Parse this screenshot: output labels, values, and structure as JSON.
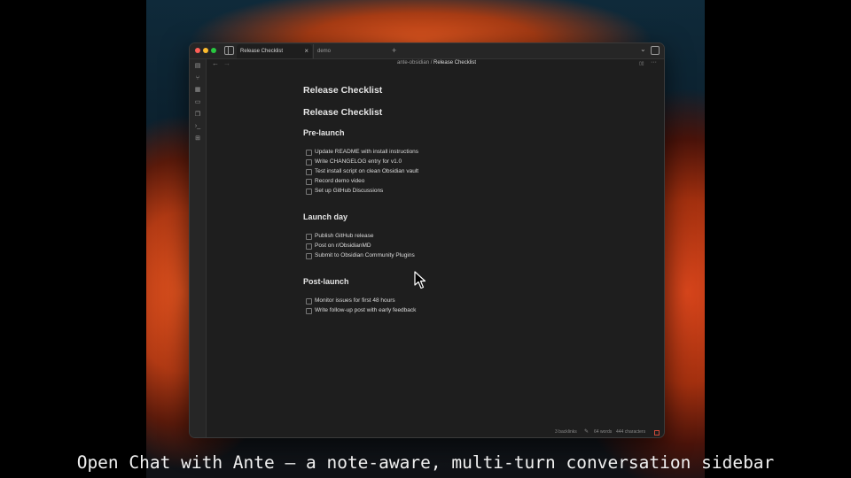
{
  "window": {
    "tabs": [
      {
        "label": "Release Checklist",
        "active": true
      },
      {
        "label": "demo",
        "active": false
      }
    ],
    "close_glyph": "×",
    "new_tab_glyph": "+",
    "chevron_glyph": "⌄"
  },
  "ribbon": {
    "icons": [
      "files-icon",
      "graph-icon",
      "canvas-icon",
      "calendar-icon",
      "templates-icon",
      "terminal-icon",
      "command-palette-icon"
    ]
  },
  "navbar": {
    "back_glyph": "←",
    "forward_glyph": "→",
    "breadcrumb_vault": "ante-obsidian",
    "breadcrumb_sep": "/",
    "breadcrumb_note": "Release Checklist",
    "reading_glyph": "▯▯",
    "more_glyph": "···"
  },
  "note": {
    "inline_title": "Release Checklist",
    "h1": "Release Checklist",
    "sections": [
      {
        "heading": "Pre-launch",
        "tasks": [
          "Update README with install instructions",
          "Write CHANGELOG entry for v1.0",
          "Test install script on clean Obsidian vault",
          "Record demo video",
          "Set up GitHub Discussions"
        ]
      },
      {
        "heading": "Launch day",
        "tasks": [
          "Publish GitHub release",
          "Post on r/ObsidianMD",
          "Submit to Obsidian Community Plugins"
        ]
      },
      {
        "heading": "Post-launch",
        "tasks": [
          "Monitor issues for first 48 hours",
          "Write follow-up post with early feedback"
        ]
      }
    ]
  },
  "statusbar": {
    "backlinks": "3 backlinks",
    "words": "64 words",
    "characters": "444 characters"
  },
  "caption": "Open Chat with Ante — a note-aware, multi-turn conversation sidebar",
  "colors": {
    "editor_bg": "#1e1e1e",
    "chrome_bg": "#262626",
    "text": "#dcdcdc"
  }
}
